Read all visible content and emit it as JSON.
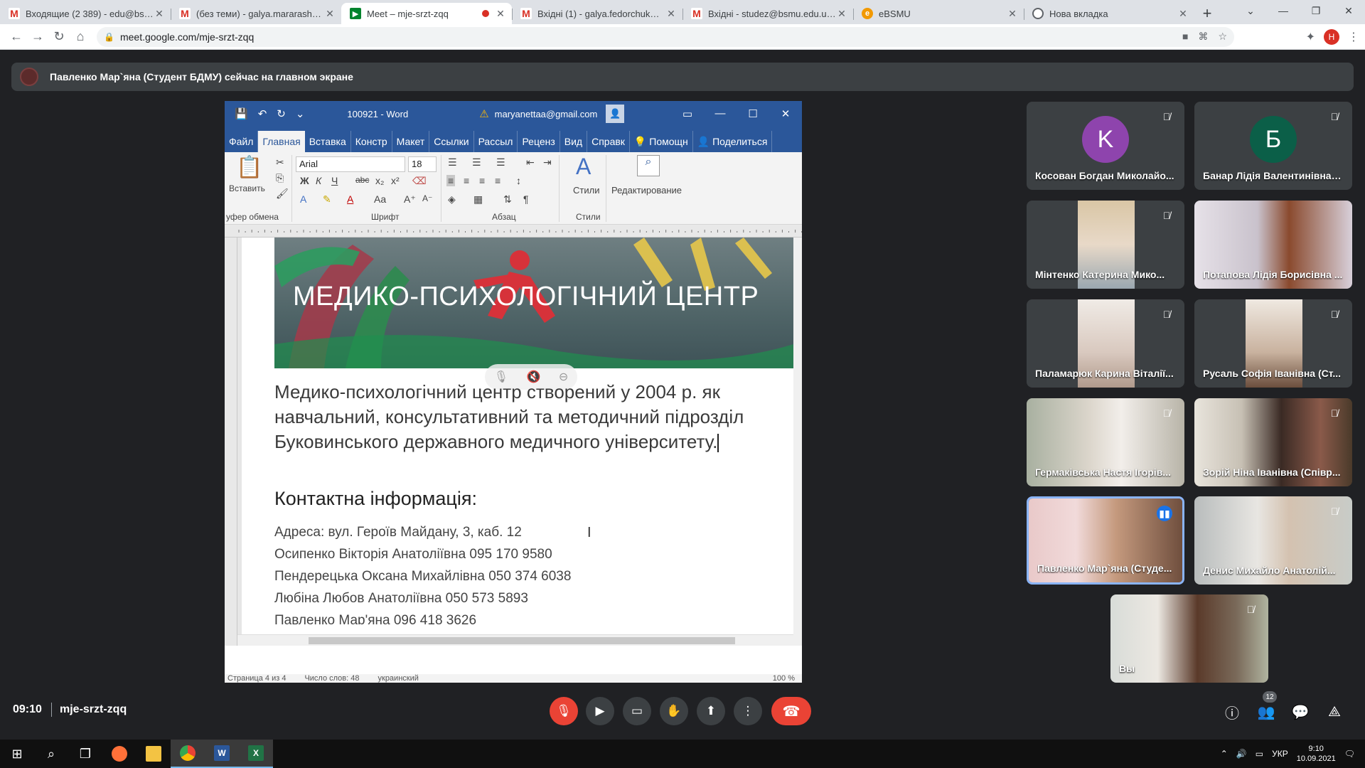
{
  "browser": {
    "tabs": [
      {
        "title": "Входящие (2 389) - edu@bsmu.edu.ua",
        "icon": "gmail-icon",
        "glyph": "M"
      },
      {
        "title": "(без теми) - galya.mararash@bsmu",
        "icon": "gmail-icon",
        "glyph": "M"
      },
      {
        "title": "Meet – mje-srzt-zqq",
        "icon": "meet-icon",
        "glyph": "▶"
      },
      {
        "title": "Вхідні (1) - galya.fedorchuk@gm",
        "icon": "gmail-icon",
        "glyph": "M"
      },
      {
        "title": "Вхідні - studez@bsmu.edu.ua - Б",
        "icon": "gmail-icon",
        "glyph": "M"
      },
      {
        "title": "eBSMU",
        "icon": "ebsmu-icon",
        "glyph": "e"
      },
      {
        "title": "Нова вкладка",
        "icon": "newtab-icon",
        "glyph": ""
      }
    ],
    "url": "meet.google.com/mje-srzt-zqq",
    "profile_initial": "Н"
  },
  "banner": {
    "text": "Павленко Мар`яна (Студент БДМУ) сейчас на главном экране"
  },
  "word": {
    "doc_title": "100921 - Word",
    "user_email": "maryanettaa@gmail.com",
    "menu": [
      "Файл",
      "Главная",
      "Вставка",
      "Констр",
      "Макет",
      "Ссылки",
      "Рассыл",
      "Реценз",
      "Вид",
      "Справк",
      "Помощн",
      "Поделиться"
    ],
    "active_menu": "Главная",
    "ribbon": {
      "paste_label": "Вставить",
      "font_name": "Arial",
      "font_size": "18",
      "styles_label": "Стили",
      "edit_label": "Редактирование",
      "groups": [
        "уфер обмена",
        "Шрифт",
        "Абзац",
        "Стили"
      ]
    },
    "hero_title": "МЕДИКО-ПСИХОЛОГІЧНИЙ ЦЕНТР",
    "paragraph": "Медико-психологічний центр створений у 2004 р. як навчальний, консультативний та методичний підрозділ Буковинського державного медичного університету.",
    "contact_heading": "Контактна інформація:",
    "contacts": [
      "Адреса: вул. Героїв Майдану, 3, каб. 12",
      "Осипенко Вікторія Анатоліївна 095 170 9580",
      "Пендерецька Оксана Михайлівна 050 374 6038",
      "Любіна Любов Анатоліївна 050 573 5893",
      "Павленко Мар'яна 096 418 3626"
    ],
    "status": {
      "page": "Страница 4 из 4",
      "words": "Число слов: 48",
      "language": "украинский",
      "zoom": "100 %"
    }
  },
  "participants": [
    {
      "name": "Косован Богдан Миколайо...",
      "initial": "K",
      "color": "#8e44ad",
      "kind": "letter"
    },
    {
      "name": "Банар Лідія Валентинівна (...",
      "initial": "Б",
      "color": "#0b5f48",
      "kind": "letter"
    },
    {
      "name": "Мінтенко Катерина Мико...",
      "kind": "video"
    },
    {
      "name": "Потапова Лідія Борисівна ...",
      "kind": "video"
    },
    {
      "name": "Паламарюк Карина Віталії...",
      "kind": "video"
    },
    {
      "name": "Русаль Софія Іванівна (Ст...",
      "kind": "video"
    },
    {
      "name": "Гермаківська Настя Ігорів...",
      "kind": "video"
    },
    {
      "name": "Зорій Ніна Іванівна (Співр...",
      "kind": "video"
    },
    {
      "name": "Павленко Мар`яна (Студе...",
      "kind": "video",
      "speaking": true
    },
    {
      "name": "Денис Михайло Анатолій...",
      "kind": "video"
    },
    {
      "name": "Вы",
      "kind": "video"
    }
  ],
  "meeting": {
    "time": "09:10",
    "code": "mje-srzt-zqq",
    "people_count": "12"
  },
  "taskbar": {
    "lang": "УКР",
    "time": "9:10",
    "date": "10.09.2021"
  }
}
